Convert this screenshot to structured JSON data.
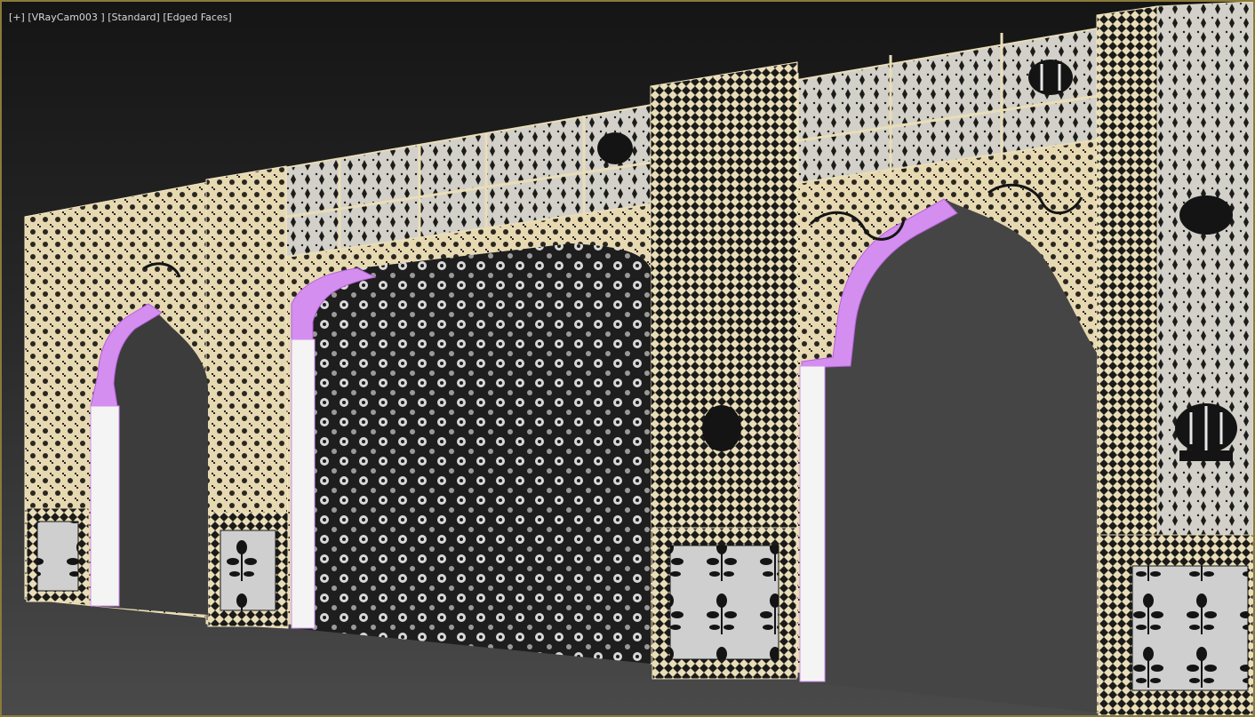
{
  "viewport": {
    "plus_menu": "[+]",
    "camera_menu": "[VRayCam003 ]",
    "shading_menu": "[Standard]",
    "display_menu": "[Edged Faces]"
  },
  "colors": {
    "frame_border": "#8a7a3a",
    "bg_top": "#151515",
    "bg_bottom": "#4a4a4a",
    "inlay_cream": "#e9ddb8",
    "inlay_dark": "#1a1a18",
    "inlay_grey": "#c9c9c9",
    "arch_selection": "#d48ef0",
    "lattice_dark": "#1e1e1e"
  },
  "scene": {
    "object": "arched wall with pietra dura inlay panels",
    "arches": 3,
    "jali_screen": 1
  }
}
